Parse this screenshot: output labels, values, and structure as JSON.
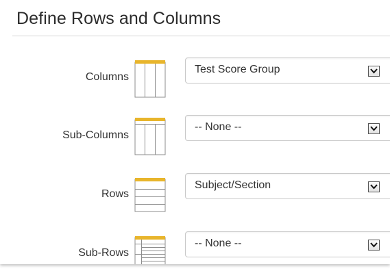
{
  "section": {
    "title": "Define Rows and Columns"
  },
  "rows": [
    {
      "label": "Columns",
      "value": "Test Score Group",
      "icon": "columns-icon"
    },
    {
      "label": "Sub-Columns",
      "value": "-- None --",
      "icon": "sub-columns-icon"
    },
    {
      "label": "Rows",
      "value": "Subject/Section",
      "icon": "rows-icon"
    },
    {
      "label": "Sub-Rows",
      "value": "-- None --",
      "icon": "sub-rows-icon"
    }
  ],
  "colors": {
    "accent": "#e8b52c",
    "icon_border": "#8c8c8c",
    "title": "#2b2b2b"
  }
}
